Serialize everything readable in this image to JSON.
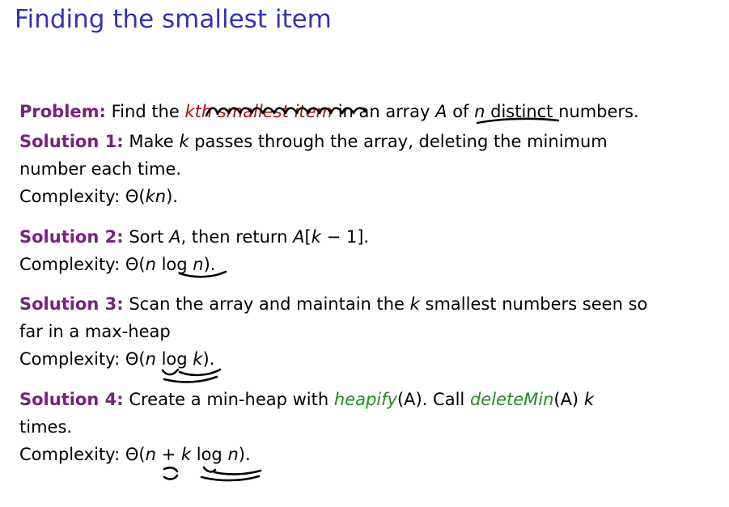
{
  "slide": {
    "title": "Finding the smallest item"
  },
  "problem": {
    "label": "Problem:",
    "text1": "Find the",
    "highlight": "kth smallest item",
    "text2": "in an array",
    "array_var": "A",
    "of": "of",
    "n_var": "n",
    "text3": "distinct numbers."
  },
  "solutions": [
    {
      "label": "Solution 1:",
      "line1_a": "Make",
      "line1_k": "k",
      "line1_b": "passes through the array, deleting the minimum",
      "line2": "number each time.",
      "complexity_label": "Complexity:",
      "complexity_open": "Θ(",
      "complexity_expr": "kn",
      "complexity_close": ")."
    },
    {
      "label": "Solution 2:",
      "line1_a": "Sort",
      "line1_A": "A",
      "line1_b": ", then return",
      "line1_A2": "A",
      "line1_c": "[",
      "line1_k": "k",
      "line1_d": "− 1].",
      "complexity_label": "Complexity:",
      "complexity_open": "Θ(",
      "complexity_n": "n",
      "complexity_log": "log",
      "complexity_n2": "n",
      "complexity_close": ")."
    },
    {
      "label": "Solution 3:",
      "line1_a": "Scan the array and maintain the",
      "line1_k": "k",
      "line1_b": "smallest numbers seen so",
      "line2": "far in a max-heap",
      "complexity_label": "Complexity:",
      "complexity_open": "Θ(",
      "complexity_n": "n",
      "complexity_log": "log",
      "complexity_k": "k",
      "complexity_close": ")."
    },
    {
      "label": "Solution 4:",
      "line1_a": "Create a min-heap with",
      "line1_f1": "heapify",
      "line1_b": "(A). Call",
      "line1_f2": "deleteMin",
      "line1_c": "(A)",
      "line1_k": "k",
      "line2": "times.",
      "complexity_label": "Complexity:",
      "complexity_open": "Θ(",
      "complexity_n": "n",
      "complexity_plus": "+",
      "complexity_k": "k",
      "complexity_log": "log",
      "complexity_n2": "n",
      "complexity_close": ")."
    }
  ],
  "colors": {
    "title": "#3333b3",
    "label": "#7a1f85",
    "highlight": "#b01313",
    "function": "#1a8f1a"
  }
}
